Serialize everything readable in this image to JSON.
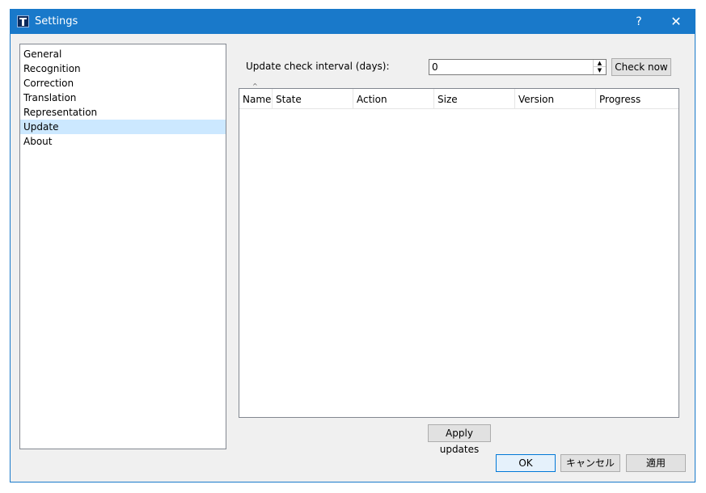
{
  "window": {
    "title": "Settings",
    "help_glyph": "?",
    "close_glyph": "✕"
  },
  "sidebar": {
    "items": [
      {
        "label": "General"
      },
      {
        "label": "Recognition"
      },
      {
        "label": "Correction"
      },
      {
        "label": "Translation"
      },
      {
        "label": "Representation"
      },
      {
        "label": "Update",
        "selected": true
      },
      {
        "label": "About"
      }
    ]
  },
  "update": {
    "interval_label": "Update check interval (days):",
    "interval_value": "0",
    "check_now_label": "Check now",
    "columns": [
      "Name",
      "State",
      "Action",
      "Size",
      "Version",
      "Progress"
    ],
    "apply_label": "Apply updates"
  },
  "footer": {
    "ok_label": "OK",
    "cancel_label": "キャンセル",
    "apply_label": "適用"
  },
  "colors": {
    "titlebar": "#1979ca",
    "selection": "#cce8ff",
    "dialog_bg": "#f0f0f0"
  }
}
